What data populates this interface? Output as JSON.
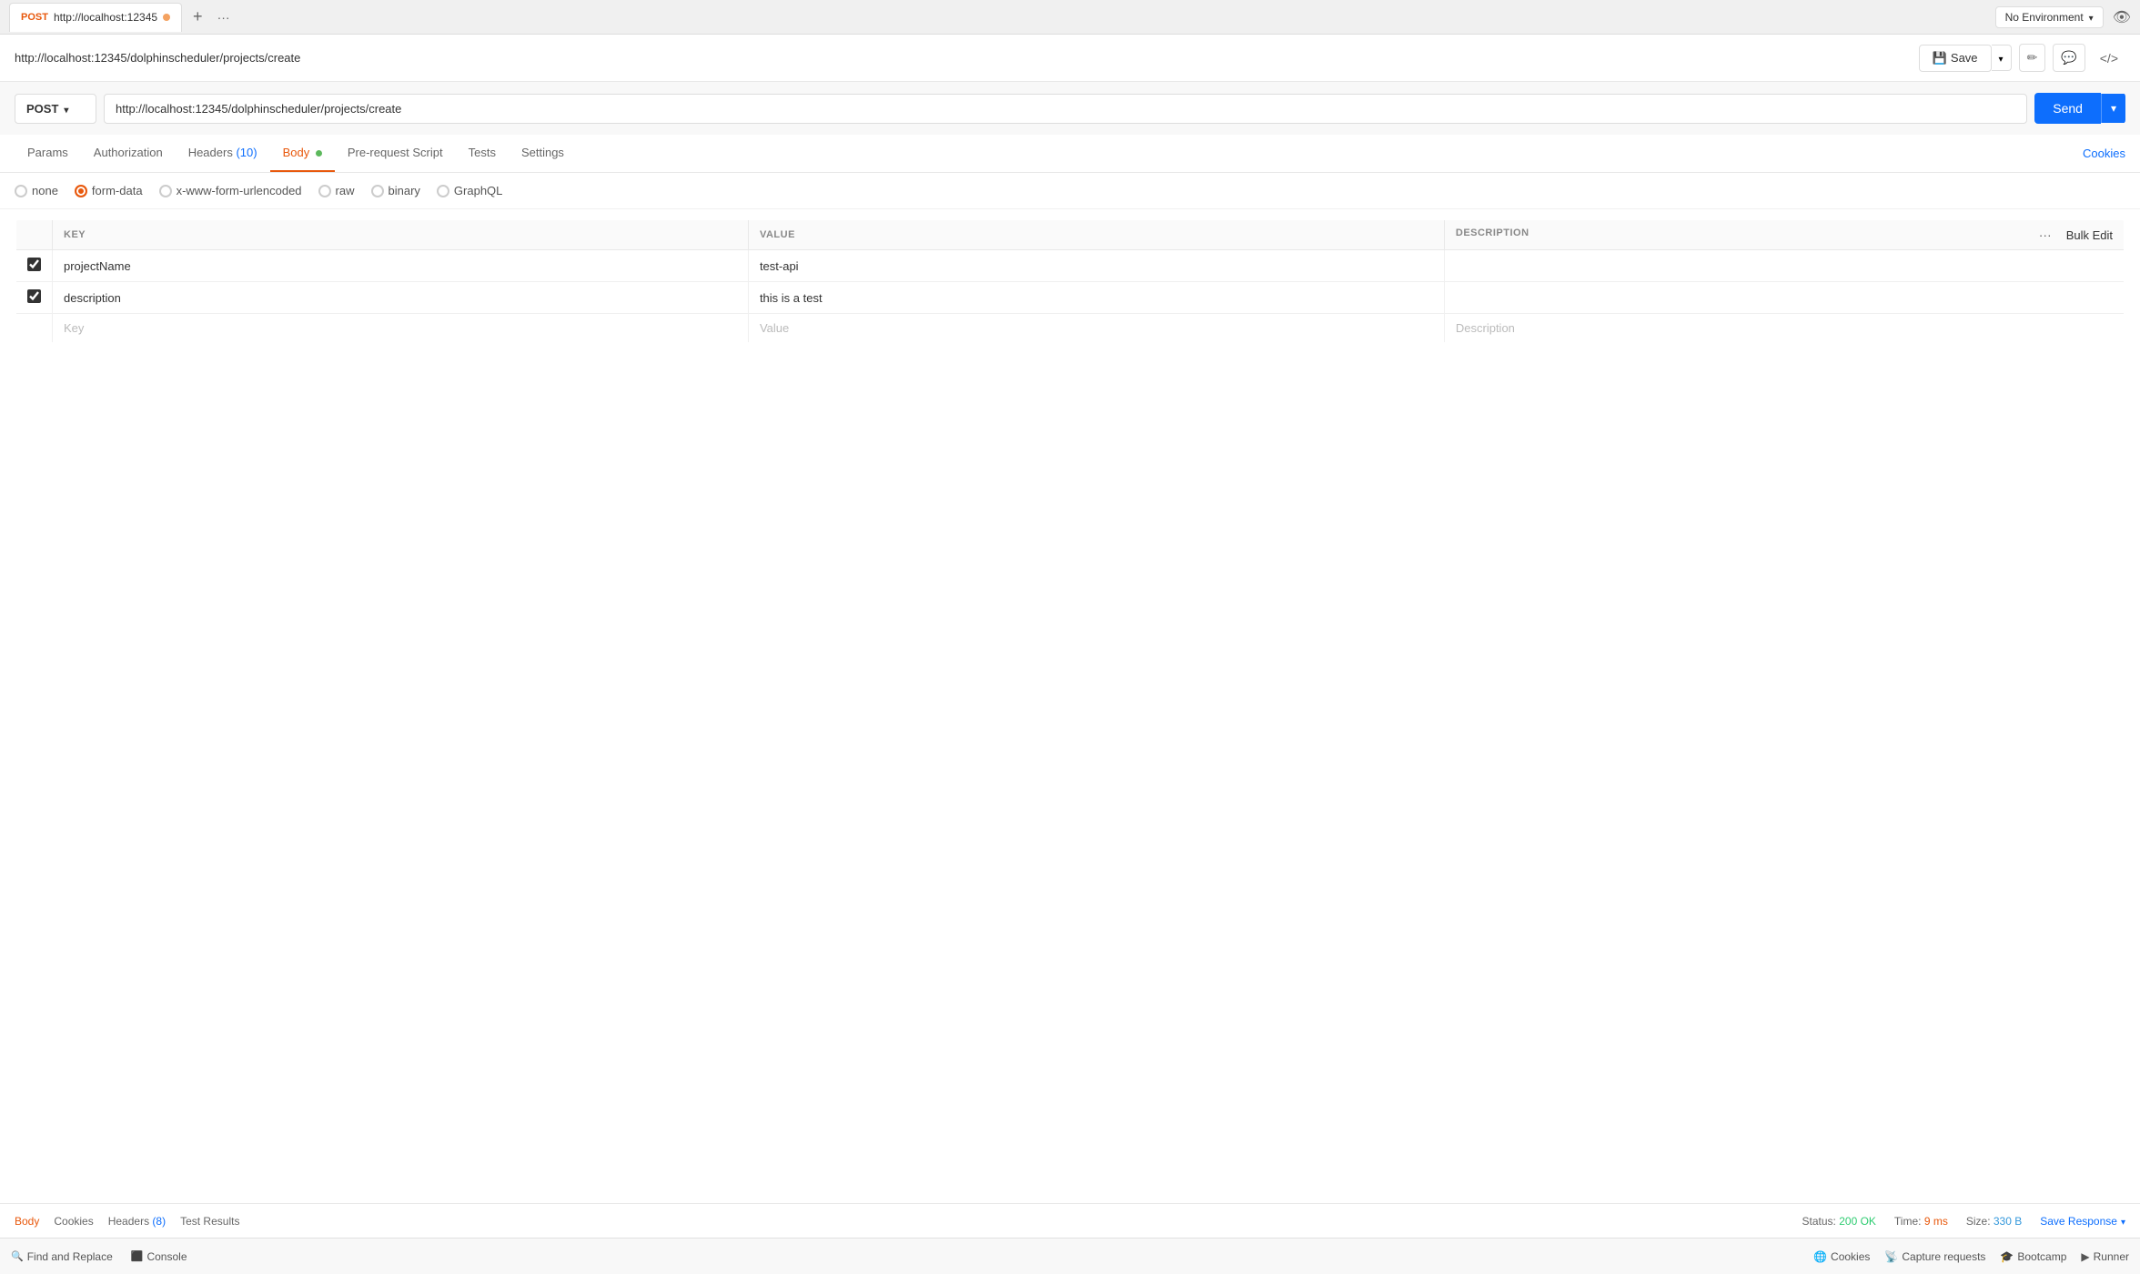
{
  "tab_bar": {
    "tab": {
      "method": "POST",
      "url": "http://localhost:12345",
      "dot_color": "#f4a261"
    },
    "env_selector": "No Environment",
    "plus_label": "+",
    "more_label": "···"
  },
  "address_bar": {
    "title": "http://localhost:12345/dolphinscheduler/projects/create",
    "save_label": "Save",
    "edit_icon": "✏",
    "comment_icon": "💬",
    "code_icon": "</>"
  },
  "request_row": {
    "method": "POST",
    "url": "http://localhost:12345/dolphinscheduler/projects/create",
    "send_label": "Send"
  },
  "tabs": [
    {
      "label": "Params",
      "active": false
    },
    {
      "label": "Authorization",
      "active": false
    },
    {
      "label": "Headers",
      "badge": "10",
      "active": false
    },
    {
      "label": "Body",
      "dot": true,
      "active": true
    },
    {
      "label": "Pre-request Script",
      "active": false
    },
    {
      "label": "Tests",
      "active": false
    },
    {
      "label": "Settings",
      "active": false
    }
  ],
  "cookies_label": "Cookies",
  "body_options": [
    {
      "label": "none",
      "selected": false
    },
    {
      "label": "form-data",
      "selected": true
    },
    {
      "label": "x-www-form-urlencoded",
      "selected": false
    },
    {
      "label": "raw",
      "selected": false
    },
    {
      "label": "binary",
      "selected": false
    },
    {
      "label": "GraphQL",
      "selected": false
    }
  ],
  "table": {
    "columns": [
      "KEY",
      "VALUE",
      "DESCRIPTION"
    ],
    "bulk_edit_label": "Bulk Edit",
    "more_label": "···",
    "rows": [
      {
        "key": "projectName",
        "value": "test-api",
        "description": "",
        "checked": true
      },
      {
        "key": "description",
        "value": "this is a test",
        "description": "",
        "checked": true
      }
    ],
    "empty_row": {
      "key_placeholder": "Key",
      "value_placeholder": "Value",
      "desc_placeholder": "Description"
    }
  },
  "bottom_bar": {
    "body_label": "Body",
    "cookies_label": "Cookies",
    "headers_label": "Headers",
    "headers_badge": "8",
    "test_results_label": "Test Results",
    "status_label": "Status:",
    "status_value": "200 OK",
    "time_label": "Time:",
    "time_value": "9 ms",
    "size_label": "Size:",
    "size_value": "330 B",
    "save_response_label": "Save Response"
  },
  "footer": {
    "find_replace": "Find and Replace",
    "console": "Console",
    "cookies": "Cookies",
    "capture": "Capture requests",
    "bootcamp": "Bootcamp",
    "runner": "Runner"
  }
}
